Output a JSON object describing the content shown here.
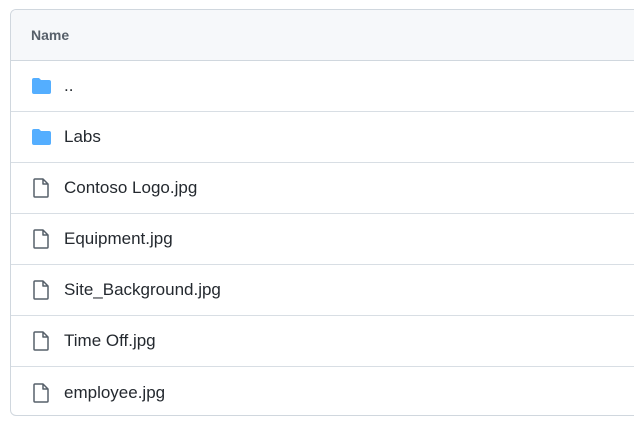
{
  "table": {
    "header": {
      "name_label": "Name"
    },
    "rows": [
      {
        "name": "..",
        "icon": "folder-icon"
      },
      {
        "name": "Labs",
        "icon": "folder-icon"
      },
      {
        "name": "Contoso Logo.jpg",
        "icon": "file-icon"
      },
      {
        "name": "Equipment.jpg",
        "icon": "file-icon"
      },
      {
        "name": "Site_Background.jpg",
        "icon": "file-icon"
      },
      {
        "name": "Time Off.jpg",
        "icon": "file-icon"
      },
      {
        "name": "employee.jpg",
        "icon": "file-icon"
      }
    ]
  },
  "colors": {
    "folder": "#54aeff",
    "file_icon": "#57606a",
    "text": "#24292f",
    "header_bg": "#f6f8fa",
    "border": "#d0d7de"
  }
}
